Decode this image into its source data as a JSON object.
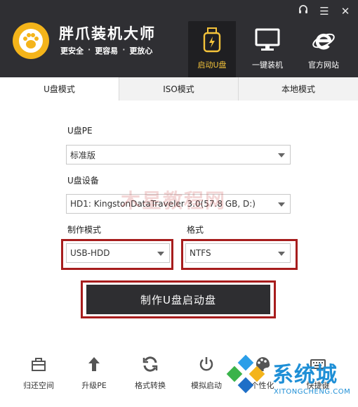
{
  "window": {
    "controls": {
      "support": "☊",
      "menu": "☰",
      "close": "✕"
    }
  },
  "brand": {
    "title": "胖爪装机大师",
    "slogan": [
      "更安全",
      "更容易",
      "更放心"
    ],
    "slogan_sep": "·"
  },
  "nav": [
    {
      "label": "启动U盘",
      "icon": "usb-drive-icon",
      "active": true
    },
    {
      "label": "一键装机",
      "icon": "monitor-icon",
      "active": false
    },
    {
      "label": "官方网站",
      "icon": "ie-browser-icon",
      "active": false
    }
  ],
  "tabs": [
    {
      "label": "U盘模式",
      "active": true
    },
    {
      "label": "ISO模式",
      "active": false
    },
    {
      "label": "本地模式",
      "active": false
    }
  ],
  "form": {
    "upe_label": "U盘PE",
    "upe_value": "标准版",
    "udevice_label": "U盘设备",
    "udevice_value": "HD1: KingstonDataTraveler 3.0(57.8 GB, D:)",
    "mode_label": "制作模式",
    "mode_value": "USB-HDD",
    "format_label": "格式",
    "format_value": "NTFS",
    "make_button": "制作U盘启动盘"
  },
  "watermark": "木星教程网",
  "toolbar": [
    {
      "label": "归还空间",
      "icon": "restore-space-icon"
    },
    {
      "label": "升级PE",
      "icon": "upgrade-arrow-icon"
    },
    {
      "label": "格式转换",
      "icon": "convert-refresh-icon"
    },
    {
      "label": "模拟启动",
      "icon": "power-icon"
    },
    {
      "label": "个性化",
      "icon": "palette-icon"
    },
    {
      "label": "快捷键",
      "icon": "keyboard-icon"
    }
  ],
  "site_logo": {
    "cn": "系统城",
    "en": "XITONGCHENG.COM"
  },
  "colors": {
    "header_bg": "#2f2f33",
    "accent_yellow": "#f4b41a",
    "highlight_red": "#a71d1d",
    "button_dark": "#2e2e31",
    "site_blue": "#1e8fd6"
  }
}
